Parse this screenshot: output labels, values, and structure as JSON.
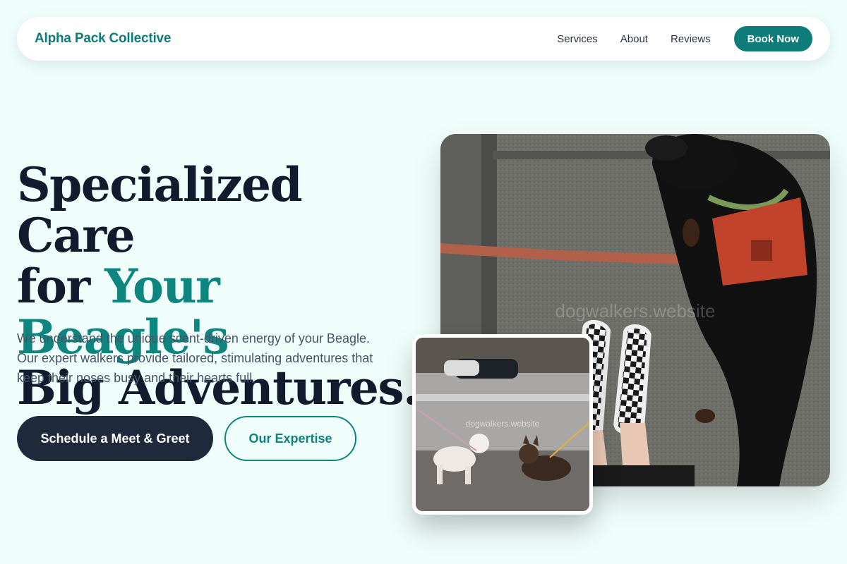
{
  "nav": {
    "brand": "Alpha Pack Collective",
    "links": [
      "Services",
      "About",
      "Reviews"
    ],
    "cta": "Book Now"
  },
  "hero": {
    "headline_line1": "Specialized Care",
    "headline_line2_prefix": "for ",
    "headline_line2_accent": "Your Beagle's",
    "headline_line3": "Big Adventures.",
    "lead": "We understand the unique scent-driven energy of your Beagle. Our expert walkers provide tailored, stimulating adventures that keep their noses busy and their hearts full.",
    "primary_cta": "Schedule a Meet & Greet",
    "secondary_cta": "Our Expertise"
  },
  "images": {
    "main_watermark": "dogwalkers.website",
    "sub_watermark": "dogwalkers.website"
  },
  "colors": {
    "background": "#effdfb",
    "accent": "#0e7c78",
    "dark": "#1e293b"
  }
}
